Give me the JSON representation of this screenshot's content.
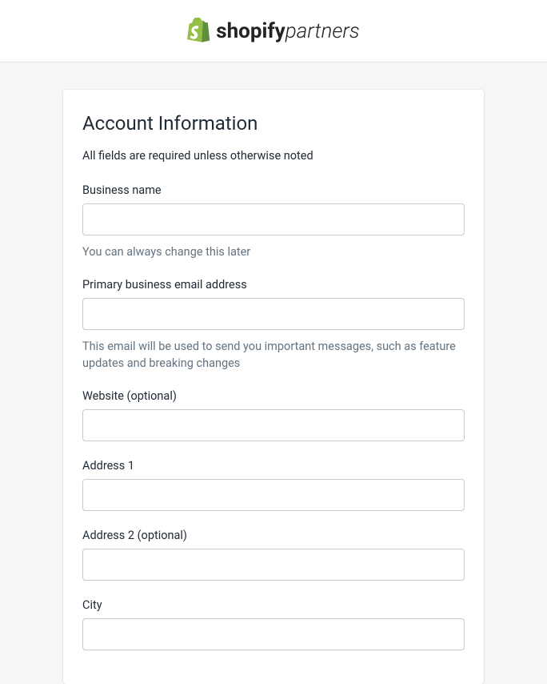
{
  "brand": {
    "name_bold": "shopify",
    "name_light": "partners"
  },
  "form": {
    "title": "Account Information",
    "subtitle": "All fields are required unless otherwise noted",
    "fields": {
      "business_name": {
        "label": "Business name",
        "value": "",
        "help": "You can always change this later"
      },
      "primary_email": {
        "label": "Primary business email address",
        "value": "",
        "help": "This email will be used to send you important messages, such as feature updates and breaking changes"
      },
      "website": {
        "label": "Website (optional)",
        "value": ""
      },
      "address1": {
        "label": "Address 1",
        "value": ""
      },
      "address2": {
        "label": "Address 2 (optional)",
        "value": ""
      },
      "city": {
        "label": "City",
        "value": ""
      }
    }
  }
}
